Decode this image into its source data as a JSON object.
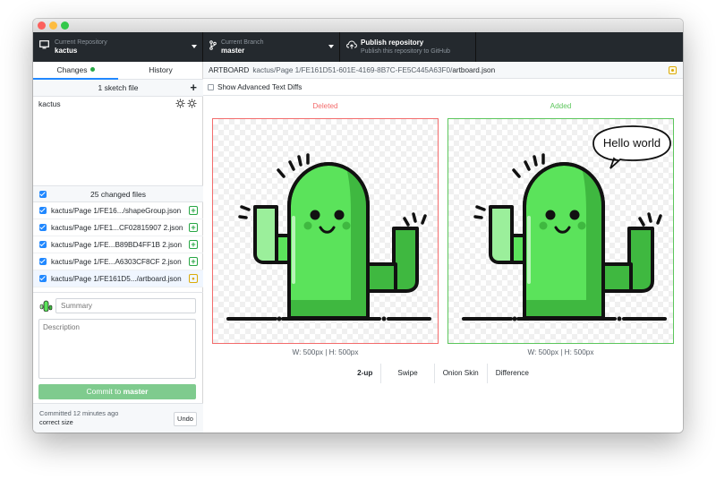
{
  "toolbar": {
    "repo": {
      "description": "Current Repository",
      "title": "kactus"
    },
    "branch": {
      "description": "Current Branch",
      "title": "master"
    },
    "publish": {
      "title": "Publish repository",
      "description": "Publish this repository to GitHub"
    }
  },
  "sidebar": {
    "tabs": [
      {
        "label": "Changes"
      },
      {
        "label": "History"
      }
    ],
    "sketch_header": "1 sketch file",
    "sketch_file": "kactus",
    "changed_header": "25 changed files",
    "files": [
      {
        "name": "kactus/Page 1/FE16.../shapeGroup.json",
        "status": "added"
      },
      {
        "name": "kactus/Page 1/FE1...CF02815907 2.json",
        "status": "added"
      },
      {
        "name": "kactus/Page 1/FE...B89BD4FF1B 2.json",
        "status": "added"
      },
      {
        "name": "kactus/Page 1/FE...A6303CF8CF 2.json",
        "status": "added"
      },
      {
        "name": "kactus/Page 1/FE161D5.../artboard.json",
        "status": "modified"
      }
    ],
    "summary_placeholder": "Summary",
    "description_placeholder": "Description",
    "commit_prefix": "Commit to ",
    "commit_branch": "master",
    "last_commit_time": "Committed 12 minutes ago",
    "last_commit_message": "correct size",
    "undo_label": "Undo"
  },
  "main": {
    "path_label": "ARTBOARD",
    "path_dir": "kactus/Page 1/FE161D51-601E-4169-8B7C-FE5C445A63F0/",
    "path_file": "artboard.json",
    "advanced_label": "Show Advanced Text Diffs",
    "deleted_label": "Deleted",
    "added_label": "Added",
    "speech_text": "Hello world",
    "deleted_dims": "W: 500px | H: 500px",
    "added_dims": "W: 500px | H: 500px",
    "modes": [
      {
        "label": "2-up"
      },
      {
        "label": "Swipe"
      },
      {
        "label": "Onion Skin"
      },
      {
        "label": "Difference"
      }
    ]
  },
  "colors": {
    "deleted": "#f36c6c",
    "added": "#5cc65c",
    "accent": "#2188ff",
    "cactus": "#5be35b",
    "cactus_dark": "#3fb840",
    "toolbar_bg": "#24292e"
  },
  "icons": {
    "repo": "monitor-icon",
    "branch": "git-branch-icon",
    "publish": "cloud-upload-icon",
    "add": "plus-icon",
    "sketch_actions": "gear-icon"
  }
}
